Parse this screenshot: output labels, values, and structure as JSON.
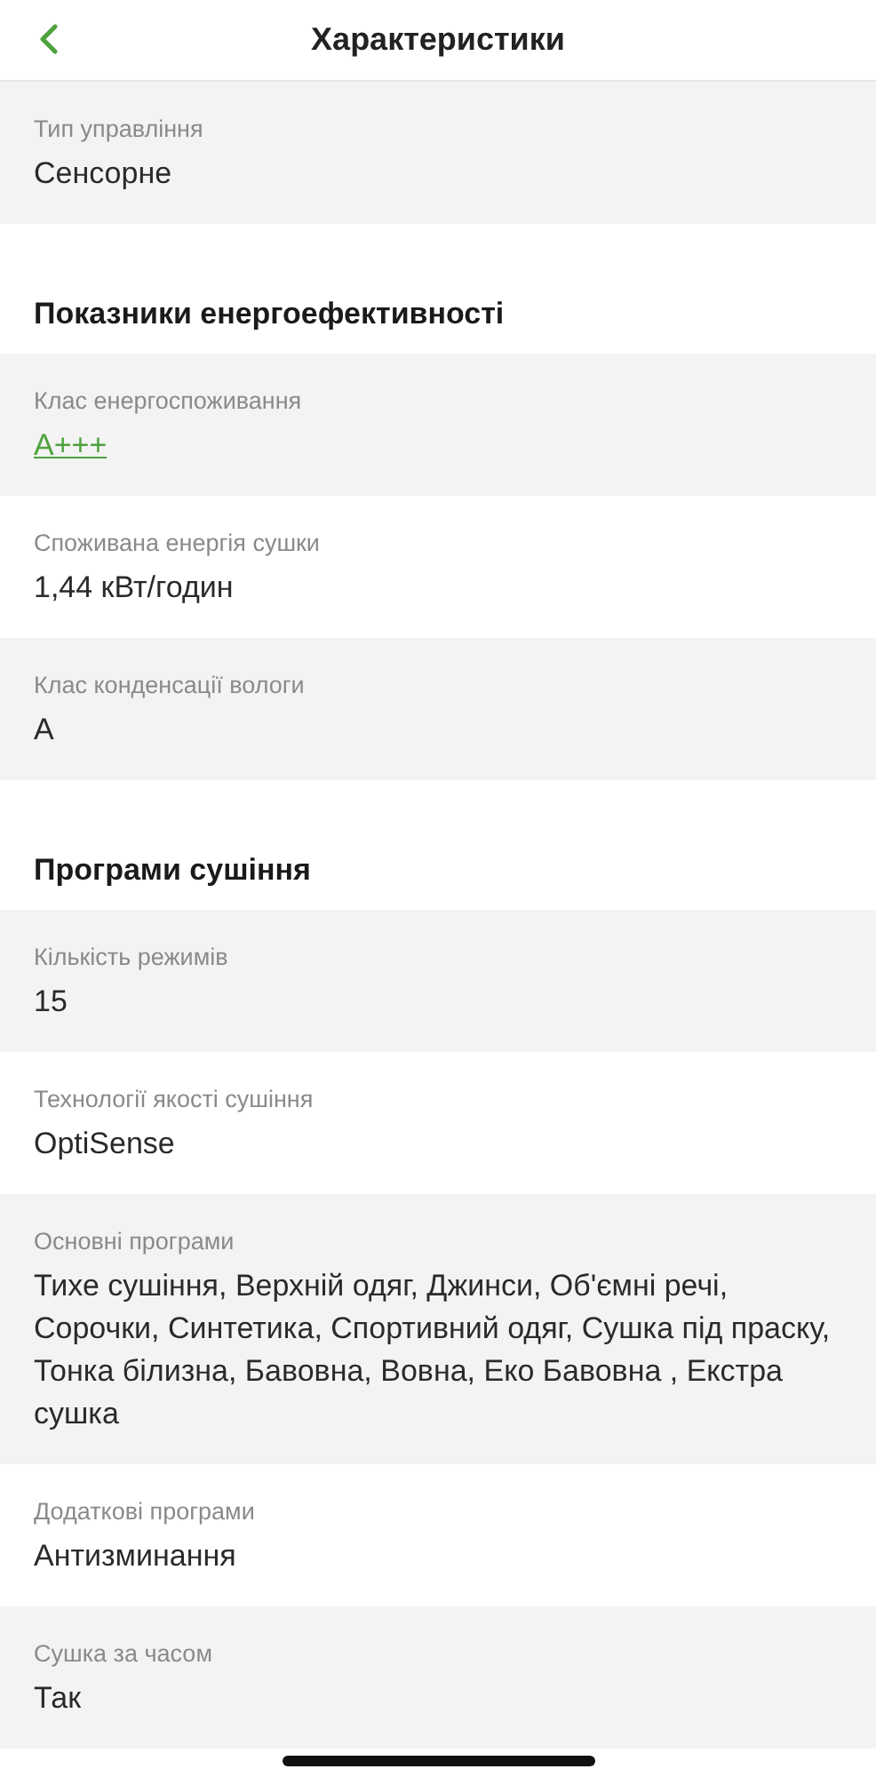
{
  "header": {
    "title": "Характеристики"
  },
  "sections": [
    {
      "rows": [
        {
          "label": "Тип управління",
          "value": "Сенсорне",
          "kind": "text"
        }
      ]
    },
    {
      "title": "Показники енергоефективності",
      "rows": [
        {
          "label": "Клас енергоспоживання",
          "value": "A+++",
          "kind": "link"
        },
        {
          "label": "Споживана енергія сушки",
          "value": "1,44 кВт/годин",
          "kind": "text"
        },
        {
          "label": "Клас конденсації вологи",
          "value": "A",
          "kind": "text"
        }
      ]
    },
    {
      "title": "Програми сушіння",
      "rows": [
        {
          "label": "Кількість режимів",
          "value": "15",
          "kind": "text"
        },
        {
          "label": "Технології якості сушіння",
          "value": "OptiSense",
          "kind": "text"
        },
        {
          "label": "Основні програми",
          "value": "Тихе сушіння, Верхній одяг, Джинси, Об'ємні речі, Сорочки, Синтетика, Спортивний одяг, Сушка під праску, Тонка білизна, Бавовна, Вовна, Еко Бавовна , Екстра сушка",
          "kind": "text"
        },
        {
          "label": "Додаткові програми",
          "value": "Антизминання",
          "kind": "text"
        },
        {
          "label": "Сушка за часом",
          "value": "Так",
          "kind": "text"
        }
      ]
    }
  ]
}
